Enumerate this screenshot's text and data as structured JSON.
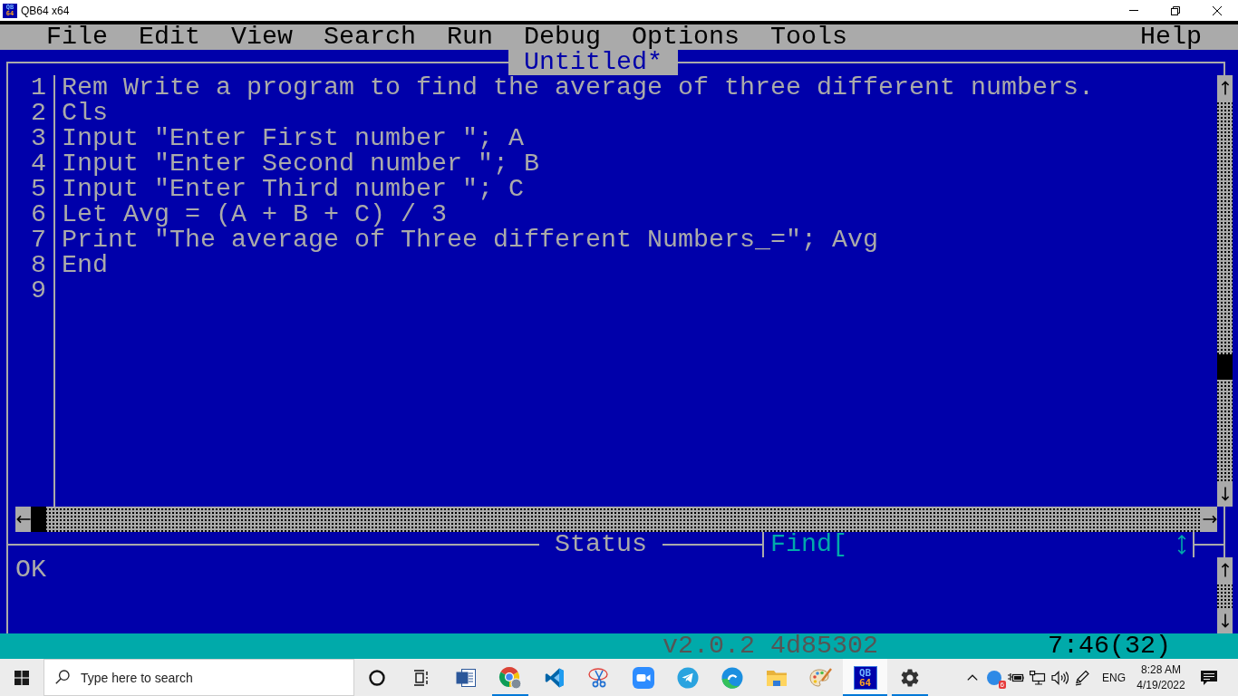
{
  "window": {
    "title": "QB64 x64",
    "logo": [
      "QB",
      "64"
    ]
  },
  "menu": {
    "left": [
      "File",
      "Edit",
      "View",
      "Search",
      "Run",
      "Debug",
      "Options",
      "Tools"
    ],
    "right": [
      "Help"
    ]
  },
  "editor": {
    "title": "Untitled*",
    "lines": [
      {
        "number": "1",
        "code": "Rem Write a program to find the average of three different numbers."
      },
      {
        "number": "2",
        "code": "Cls"
      },
      {
        "number": "3",
        "code": "Input \"Enter First number \"; A"
      },
      {
        "number": "4",
        "code": "Input \"Enter Second number \"; B"
      },
      {
        "number": "5",
        "code": "Input \"Enter Third number \"; C"
      },
      {
        "number": "6",
        "code": "Let Avg = (A + B + C) / 3"
      },
      {
        "number": "7",
        "code": "Print \"The average of Three different Numbers_=\"; Avg"
      },
      {
        "number": "8",
        "code": "End"
      },
      {
        "number": "9"
      }
    ]
  },
  "status": {
    "title": "Status",
    "message": "OK",
    "find": {
      "label": "Find["
    }
  },
  "status_bar": {
    "version": "v2.0.2 4d85302",
    "cursor": "7:46(32)"
  },
  "taskbar": {
    "search": {
      "placeholder": "Type here to search"
    },
    "buttons": [
      {
        "kind": "ring",
        "running": false,
        "selected": false
      },
      {
        "kind": "task-view",
        "running": false,
        "selected": false
      },
      {
        "kind": "document",
        "running": false,
        "selected": false
      },
      {
        "kind": "browser",
        "running": true,
        "selected": false
      },
      {
        "kind": "ribbon",
        "running": false,
        "selected": false
      },
      {
        "kind": "scissors",
        "running": false,
        "selected": false
      },
      {
        "kind": "video",
        "running": false,
        "selected": false
      },
      {
        "kind": "plane",
        "running": false,
        "selected": false
      },
      {
        "kind": "swirl",
        "running": false,
        "selected": false
      },
      {
        "kind": "folder",
        "running": false,
        "selected": false
      },
      {
        "kind": "palette",
        "running": false,
        "selected": false
      },
      {
        "kind": "logo",
        "running": true,
        "selected": true,
        "logo": [
          "QB",
          "64"
        ]
      },
      {
        "kind": "gear",
        "running": true,
        "selected": false
      }
    ],
    "tray": {
      "badge": "6",
      "language": "ENG",
      "time": "8:28 AM",
      "date": "4/19/2022"
    }
  }
}
